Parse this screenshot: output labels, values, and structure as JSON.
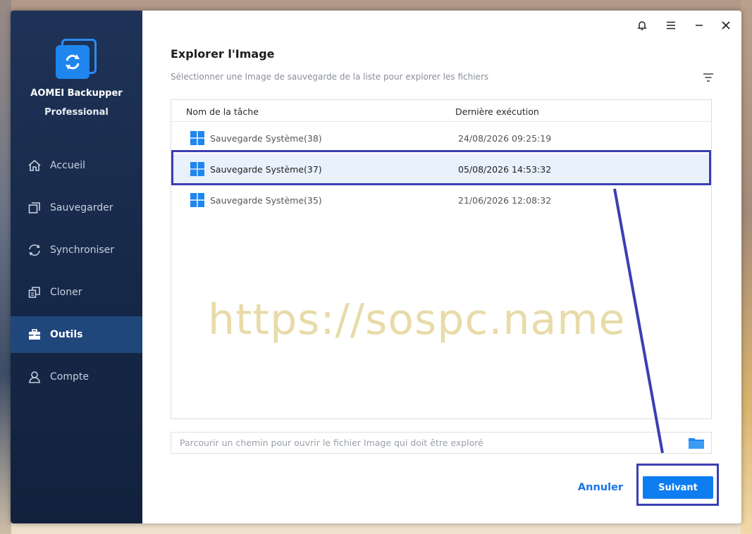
{
  "app": {
    "name_line1": "AOMEI Backupper",
    "name_line2": "Professional"
  },
  "sidebar": {
    "items": [
      {
        "label": "Accueil",
        "icon": "home-icon"
      },
      {
        "label": "Sauvegarder",
        "icon": "backup-icon"
      },
      {
        "label": "Synchroniser",
        "icon": "sync-icon"
      },
      {
        "label": "Cloner",
        "icon": "clone-icon"
      },
      {
        "label": "Outils",
        "icon": "toolbox-icon",
        "active": true
      },
      {
        "label": "Compte",
        "icon": "user-icon"
      }
    ]
  },
  "titlebar": {
    "icons": [
      "bell-icon",
      "menu-icon",
      "minimize-icon",
      "close-icon"
    ]
  },
  "dialog": {
    "title": "Explorer l'Image",
    "subtitle": "Sélectionner une Image de sauvegarde de la liste pour explorer les fichiers",
    "filter_icon": "filter-icon"
  },
  "table": {
    "columns": [
      "Nom de la tâche",
      "Dernière exécution"
    ],
    "rows": [
      {
        "name": "Sauvegarde Système(38)",
        "date": "24/08/2026 09:25:19",
        "selected": false
      },
      {
        "name": "Sauvegarde Système(37)",
        "date": "05/08/2026 14:53:32",
        "selected": true
      },
      {
        "name": "Sauvegarde Système(35)",
        "date": "21/06/2026 12:08:32",
        "selected": false
      }
    ]
  },
  "watermark": "https://sospc.name",
  "path_input": {
    "value": "",
    "placeholder": "Parcourir un chemin pour ouvrir le fichier Image qui doit être exploré"
  },
  "buttons": {
    "cancel": "Annuler",
    "next": "Suivant"
  },
  "colors": {
    "accent": "#0f7df2",
    "sidebar_bg": "#1a2d50",
    "sidebar_active": "#20477c",
    "annotation": "#3b3fb3",
    "watermark": "#e8dba9"
  }
}
